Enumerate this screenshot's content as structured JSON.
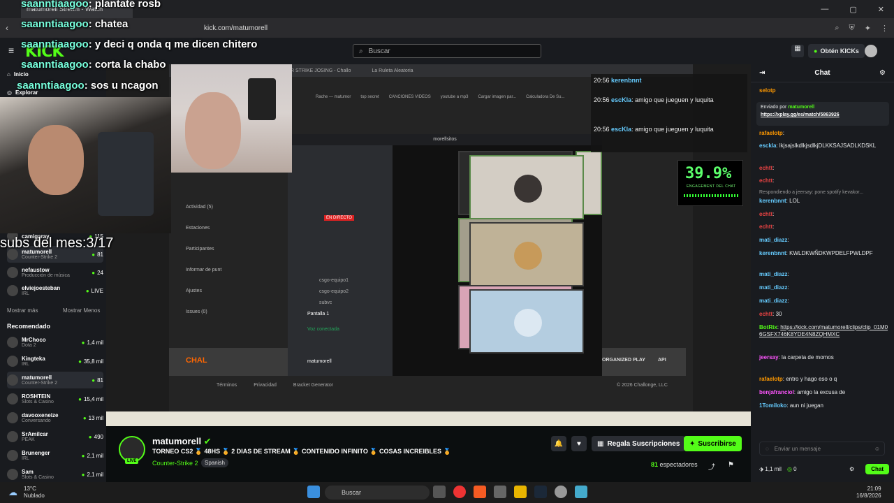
{
  "browser": {
    "tab_title": "matumorell Stream - Watch",
    "url": "kick.com/matumorell"
  },
  "header": {
    "logo": "KICK",
    "search_placeholder": "Buscar",
    "get_kicks": "Obtén KICKs"
  },
  "sidebar": {
    "home": "Inicio",
    "explore": "Explorar",
    "following": [
      {
        "name": "camigaray",
        "count": "115"
      },
      {
        "name": "matumorell",
        "category": "Counter-Strike 2",
        "count": "81"
      },
      {
        "name": "nefaustow",
        "category": "Producción de música",
        "count": "24"
      },
      {
        "name": "elviejoesteban",
        "category": "IRL",
        "count": "LIVE"
      }
    ],
    "show_more": "Mostrar más",
    "show_less": "Mostrar Menos",
    "recommended_title": "Recomendado",
    "recommended": [
      {
        "name": "MrChoco",
        "category": "Dota 2",
        "count": "1,4 mil"
      },
      {
        "name": "Kingteka",
        "category": "IRL",
        "count": "35,8 mil"
      },
      {
        "name": "matumorell",
        "category": "Counter-Strike 2",
        "count": "81"
      },
      {
        "name": "ROSHTEIN",
        "category": "Slots & Casino",
        "count": "15,4 mil"
      },
      {
        "name": "davooxeneize",
        "category": "Conversando",
        "count": "13 mil"
      },
      {
        "name": "SrAmilcar",
        "category": "PEAK",
        "count": "490"
      },
      {
        "name": "Brunenger",
        "category": "IRL",
        "count": "2,1 mil"
      },
      {
        "name": "Sam",
        "category": "Slots & Casino",
        "count": "2,1 mil"
      }
    ]
  },
  "overlay_chat": [
    {
      "user": "saanntiaagoo",
      "text": "plantate rosb"
    },
    {
      "user": "saanntiaagoo",
      "text": "chatea"
    },
    {
      "user": "saanntiaagoo",
      "text": "y deci q onda q me dicen chitero"
    },
    {
      "user": "saanntiaagoo",
      "text": "corta la chabo"
    },
    {
      "user": "saanntiaagoo",
      "text": "sos u ncagon"
    }
  ],
  "subs_text": "subs del mes:3/17",
  "capture": {
    "tabs": [
      "NTER STRIKE JOSING - Challo",
      "La Ruleta Aleatoria"
    ],
    "bookmarks": [
      "Rache — matumor",
      "top secret",
      "CANCIONES VIDEOS",
      "youtube a mp3",
      "Cargar imagen par...",
      "Calculadora De Su..."
    ],
    "discord_server": "morellsitos",
    "live_label": "EN DIRECTO",
    "voice_connected": "Voz conectada",
    "channel": "Pantalla 1",
    "user": "matumorell",
    "channels": [
      "csgo-equipo1",
      "csgo-equipo2",
      "subvc"
    ],
    "menu": [
      "Actividad (5)",
      "Estaciones",
      "Participantes",
      "Informar de punt",
      "Ajustes",
      "Issues (0)"
    ],
    "footer": [
      "Términos",
      "Privacidad",
      "Bracket Generator"
    ],
    "copyright": "© 2026 Challonge, LLC",
    "challonge": "CHAL",
    "organized_play": "ORGANIZED PLAY",
    "api": "API"
  },
  "engagement": {
    "value": "39.9%",
    "label": "ENGAGEMENT DEL CHAT"
  },
  "stream_overlay_chat": [
    {
      "time": "20:56",
      "user": "kerenbnnt",
      "text": ""
    },
    {
      "time": "20:56",
      "user": "escKla",
      "text": "amigo que jueguen y luquita"
    },
    {
      "time": "20:56",
      "user": "escKla",
      "text": "amigo que jueguen y luquita"
    }
  ],
  "stream_info": {
    "streamer": "matumorell",
    "live": "LIVE",
    "title": "TORNEO CS2 🏅 48HS 🏅 2 DIAS DE STREAM 🏅 CONTENIDO INFINITO 🏅 COSAS INCREIBLES 🏅",
    "category": "Counter-Strike 2",
    "language": "Spanish",
    "gift_subs": "Regala Suscripciones",
    "subscribe": "Suscribirse",
    "viewers_count": "81",
    "viewers_label": "espectadores"
  },
  "chat": {
    "title": "Chat",
    "pinned_by": "Enviado por",
    "pinned_user": "matumorell",
    "pinned_link": "https://xplay.gg/es/match/5863926",
    "messages": [
      {
        "user": "selotp",
        "text": ""
      },
      {
        "user": "rafaelotp",
        "text": ""
      },
      {
        "user": "esckla",
        "text": "lkjsajslkdlkjsdlkjDLKKSAJSADLKDSKL"
      },
      {
        "user": "echtt",
        "text": ""
      },
      {
        "user": "echtt",
        "text": ""
      },
      {
        "user": "",
        "text": "Respondiendo a jeersay: pone spotify kevakor..."
      },
      {
        "user": "kerenbnnt",
        "text": "LOL"
      },
      {
        "user": "echtt",
        "text": ""
      },
      {
        "user": "echtt",
        "text": ""
      },
      {
        "user": "mati_diazz",
        "text": ""
      },
      {
        "user": "kerenbnnt",
        "text": "KWLDKWÑDKWPDELFPWLDPF"
      },
      {
        "user": "mati_diazz",
        "text": ""
      },
      {
        "user": "mati_diazz",
        "text": ""
      },
      {
        "user": "mati_diazz",
        "text": ""
      },
      {
        "user": "echtt",
        "text": "30"
      },
      {
        "user": "BotRix",
        "text": "https://kick.com/matumorell/clips/clip_01M06GSFX746K8YDE4N8ZQHMXC"
      },
      {
        "user": "jeersay",
        "text": "la carpeta de momos"
      },
      {
        "user": "rafaelotp",
        "text": "entro y hago eso o q"
      },
      {
        "user": "benjafranciol",
        "text": "amigo la excusa de"
      },
      {
        "user": "1Tomiloko",
        "text": "aun ni juegan"
      }
    ],
    "input_placeholder": "Enviar un mensaje",
    "kicks": "1,1 mil",
    "points": "0",
    "send": "Chat"
  },
  "taskbar": {
    "weather_temp": "13°C",
    "weather_desc": "Nublado",
    "search": "Buscar",
    "time": "21:09",
    "date": "16/8/2026"
  },
  "colors": {
    "accent": "#53fc18",
    "bg": "#0b0e0f",
    "panel": "#191b1f"
  }
}
